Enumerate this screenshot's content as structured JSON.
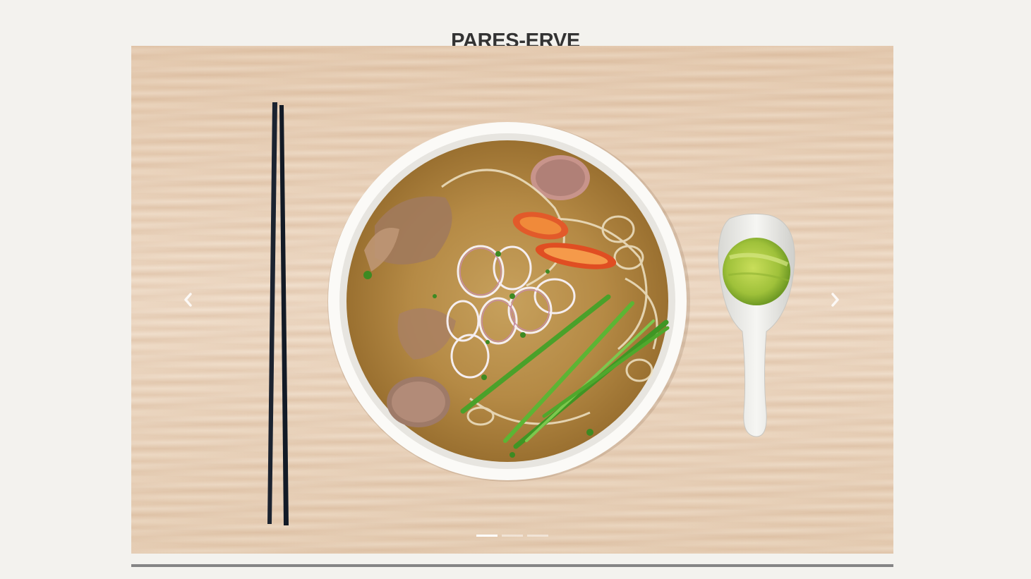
{
  "site": {
    "title": "PARES-ERVE"
  },
  "carousel": {
    "image": "pho-bowl-photo",
    "prev_icon": "chevron-left-icon",
    "next_icon": "chevron-right-icon",
    "slide_count": 3,
    "active_index": 0
  },
  "colors": {
    "background": "#f3f2ee",
    "title": "#333333",
    "divider": "#858585"
  }
}
